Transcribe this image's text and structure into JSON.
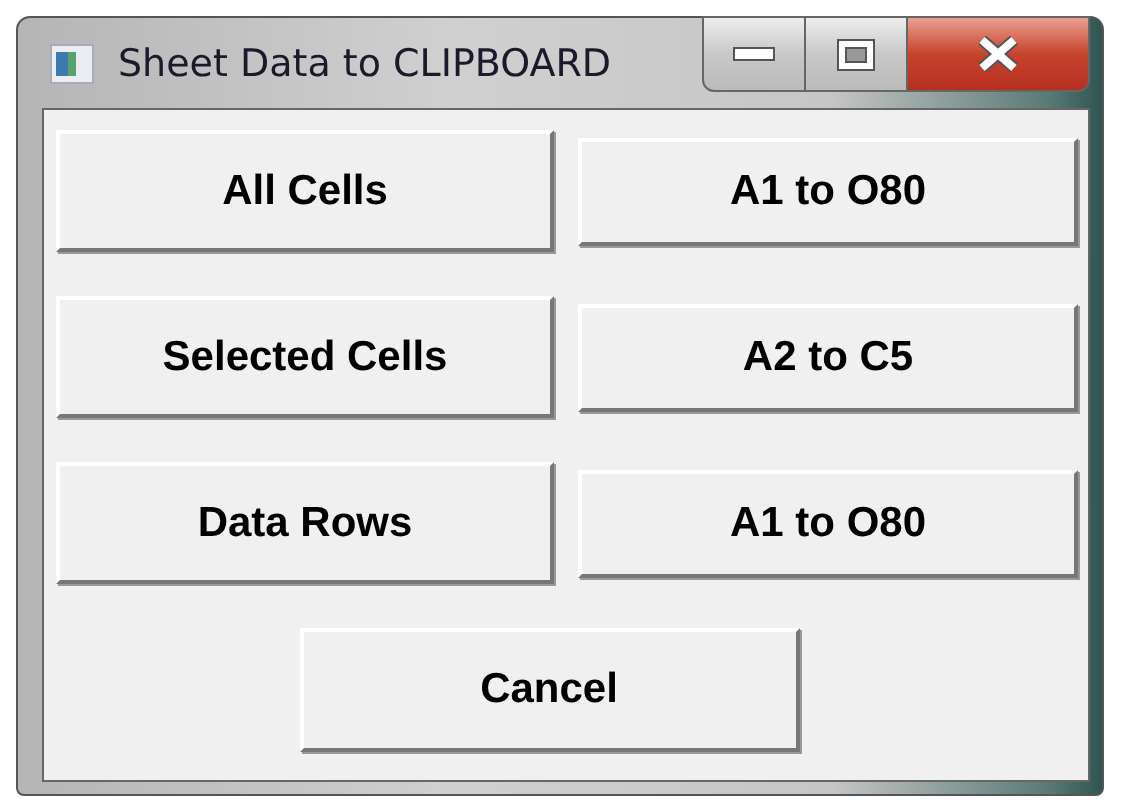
{
  "window": {
    "title": "Sheet Data to CLIPBOARD"
  },
  "rows": [
    {
      "action": "All Cells",
      "range": "A1 to O80"
    },
    {
      "action": "Selected Cells",
      "range": "A2 to C5"
    },
    {
      "action": "Data Rows",
      "range": "A1 to O80"
    }
  ],
  "cancel": "Cancel"
}
